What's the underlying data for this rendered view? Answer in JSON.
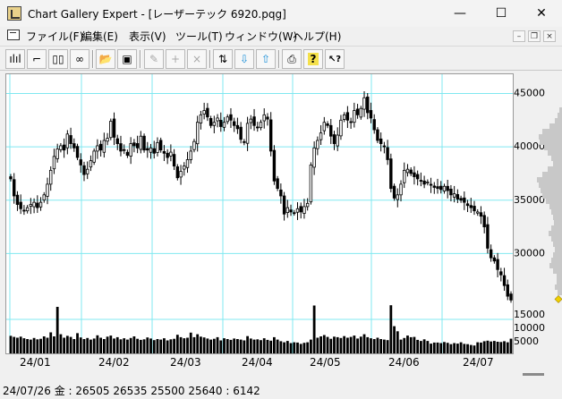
{
  "window": {
    "title": "Chart Gallery Expert - [レーザーテック 6920.pqg]",
    "minimize_glyph": "—",
    "maximize_glyph": "☐",
    "close_glyph": "✕"
  },
  "menu": {
    "items": [
      "ファイル(F)",
      "編集(E)",
      "表示(V)",
      "ツール(T)",
      "ウィンドウ(W)",
      "ヘルプ(H)"
    ],
    "mdi_minimize": "–",
    "mdi_restore": "❐",
    "mdi_close": "×"
  },
  "toolbar": {
    "buttons": [
      {
        "icon": "candlestick-chart-icon",
        "glyph": "ılıl"
      },
      {
        "icon": "step-chart-icon",
        "glyph": "⌐"
      },
      {
        "icon": "dual-pane-icon",
        "glyph": "▯▯"
      },
      {
        "icon": "binoculars-icon",
        "glyph": "∞"
      },
      {
        "icon": "open-folder-icon",
        "glyph": "📂"
      },
      {
        "icon": "save-disk-icon",
        "glyph": "▣"
      },
      {
        "icon": "edit-disabled-icon",
        "glyph": "✎"
      },
      {
        "icon": "add-disabled-icon",
        "glyph": "+"
      },
      {
        "icon": "delete-disabled-icon",
        "glyph": "×"
      },
      {
        "icon": "refresh-icon",
        "glyph": "⇅"
      },
      {
        "icon": "download-arrow-icon",
        "glyph": "⇩"
      },
      {
        "icon": "upload-arrow-icon",
        "glyph": "⇧"
      },
      {
        "icon": "print-icon",
        "glyph": "⎙"
      },
      {
        "icon": "help-icon",
        "glyph": "?"
      },
      {
        "icon": "context-help-icon",
        "glyph": "↖?"
      }
    ]
  },
  "status": {
    "text": "24/07/26 金 : 26505 26535 25500 25640 : 6142"
  },
  "colors": {
    "grid": "#80e8f0",
    "candle": "#000000",
    "volume": "#000000",
    "histogram": "#c8c8c8",
    "marker": "#f0d000"
  },
  "chart_data": {
    "type": "candlestick",
    "x_tick_labels": [
      "24/01",
      "24/02",
      "24/03",
      "24/04",
      "24/05",
      "24/06",
      "24/07"
    ],
    "price_axis": {
      "ticks": [
        45000,
        40000,
        35000,
        30000
      ],
      "range": [
        24500,
        46300
      ]
    },
    "volume_axis": {
      "ticks": [
        15000,
        10000,
        5000
      ],
      "range": [
        0,
        19000
      ]
    },
    "last_close": 25640,
    "closes": [
      37000,
      35400,
      34600,
      34200,
      34000,
      34300,
      34600,
      34800,
      34300,
      34800,
      35500,
      36500,
      37800,
      39100,
      39800,
      40100,
      39700,
      41200,
      40300,
      39900,
      39000,
      38300,
      37400,
      37900,
      38700,
      39600,
      40100,
      39700,
      40600,
      40800,
      42400,
      40900,
      40300,
      39600,
      39700,
      39200,
      40300,
      40100,
      39900,
      41000,
      39700,
      39700,
      39900,
      39400,
      40400,
      39700,
      39400,
      39000,
      39500,
      38200,
      37100,
      37700,
      38200,
      38800,
      39600,
      40500,
      42300,
      43000,
      43400,
      42800,
      42000,
      42300,
      42700,
      41900,
      42300,
      42800,
      42500,
      42000,
      41700,
      40700,
      40400,
      42200,
      42600,
      42000,
      41800,
      42300,
      43000,
      42600,
      39600,
      36800,
      36100,
      35400,
      33700,
      34300,
      33900,
      33800,
      34200,
      33900,
      34400,
      34700,
      38300,
      39900,
      40600,
      41300,
      42300,
      42000,
      41000,
      40300,
      41100,
      42500,
      43000,
      42500,
      42300,
      43400,
      43000,
      43600,
      44600,
      43200,
      42700,
      41600,
      40600,
      40300,
      40000,
      38800,
      36100,
      35200,
      35500,
      36500,
      37800,
      37900,
      37500,
      37200,
      37000,
      36800,
      36500,
      36700,
      36400,
      36200,
      36100,
      36000,
      36300,
      35900,
      35500,
      35600,
      35100,
      35000,
      34800,
      34500,
      34300,
      34000,
      33900,
      33500,
      32500,
      30500,
      29600,
      29300,
      28500,
      28000,
      27000,
      26000,
      25640
    ],
    "volumes": [
      7200,
      6800,
      6500,
      6900,
      6300,
      6000,
      5800,
      6400,
      5900,
      6100,
      7000,
      6500,
      8500,
      7000,
      10500,
      7800,
      6500,
      7200,
      6800,
      6000,
      8200,
      6600,
      6000,
      6400,
      5800,
      6200,
      7400,
      6500,
      6000,
      6900,
      7300,
      6200,
      6700,
      5900,
      6300,
      5800,
      6400,
      7000,
      6100,
      5700,
      5900,
      6600,
      6200,
      5600,
      6000,
      5800,
      6300,
      5500,
      5900,
      6100,
      7600,
      6700,
      6300,
      6500,
      8400,
      6700,
      7800,
      6900,
      6600,
      6200,
      5800,
      6100,
      6700,
      5500,
      6300,
      6000,
      5700,
      6200,
      6000,
      5800,
      5500,
      7100,
      6200,
      5800,
      5900,
      5600,
      6300,
      5700,
      5400,
      6700,
      5800,
      5200,
      4800,
      5300,
      4500,
      4800,
      4700,
      4200,
      4600,
      4800,
      5800,
      6600,
      6500,
      7000,
      7500,
      6800,
      6100,
      6900,
      6700,
      6400,
      7100,
      6500,
      6800,
      7300,
      6200,
      6900,
      7800,
      6700,
      6300,
      6000,
      6500,
      6000,
      5800,
      5600,
      6100,
      10800,
      8900,
      5800,
      6400,
      7300,
      6700,
      6800,
      5700,
      5300,
      5900,
      5300,
      4300,
      4700,
      4700,
      4500,
      4900,
      4600,
      4100,
      4500,
      4300,
      4800,
      4200,
      4100,
      3800,
      3600,
      4800,
      4700,
      5200,
      5400,
      5100,
      5300,
      5000,
      4900,
      5200,
      4800,
      6142
    ],
    "spikes": [
      {
        "index": 14,
        "volume": 18000
      },
      {
        "index": 91,
        "volume": 18500
      },
      {
        "index": 114,
        "volume": 18600
      }
    ]
  }
}
